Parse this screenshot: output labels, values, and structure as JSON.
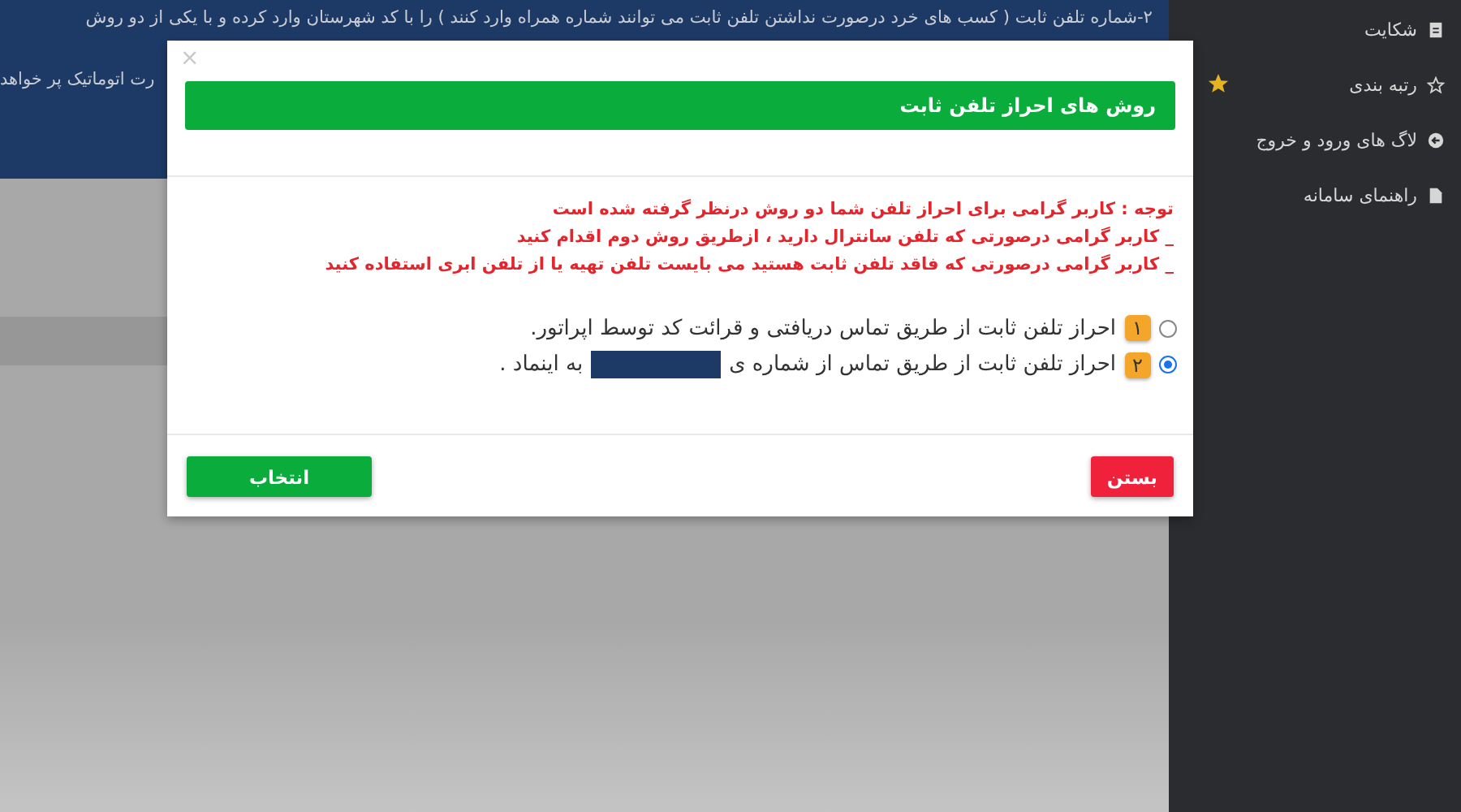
{
  "background": {
    "notice_lines": [
      "۲-شماره تلفن ثابت ( کسب های خرد درصورت نداشتن تلفن ثابت می توانند شماره همراه وارد کنند ) را با کد شهرستان وارد کرده و با یکی از دو روش",
      "رت اتوماتیک پر خواهد"
    ]
  },
  "sidebar": {
    "items": [
      {
        "label": "شکایت",
        "starred": false
      },
      {
        "label": "رتبه بندی",
        "starred": true
      },
      {
        "label": "لاگ های ورود و خروج",
        "starred": false
      },
      {
        "label": "راهنمای سامانه",
        "starred": false
      }
    ]
  },
  "modal": {
    "close": "×",
    "title": "روش های احراز تلفن ثابت",
    "notes": [
      "توجه : کاربر گرامی برای احراز تلفن شما دو روش درنظر گرفته شده است",
      "_ کاربر گرامی درصورتی که تلفن سانترال دارید ، ازطریق روش دوم اقدام کنید",
      "_ کاربر گرامی درصورتی که فاقد تلفن ثابت هستید می بایست تلفن تهیه یا از تلفن ابری استفاده کنید"
    ],
    "options": [
      {
        "number": "۱",
        "text": "احراز تلفن ثابت از طریق تماس دریافتی و قرائت کد توسط اپراتور.",
        "selected": false
      },
      {
        "number": "۲",
        "text": "احراز تلفن ثابت از طریق تماس از شماره ی",
        "redacted": true,
        "text_after": "به اینماد .",
        "selected": true
      }
    ],
    "buttons": [
      {
        "label": "بستن",
        "kind": "danger"
      },
      {
        "label": "انتخاب",
        "kind": "primary"
      }
    ]
  }
}
